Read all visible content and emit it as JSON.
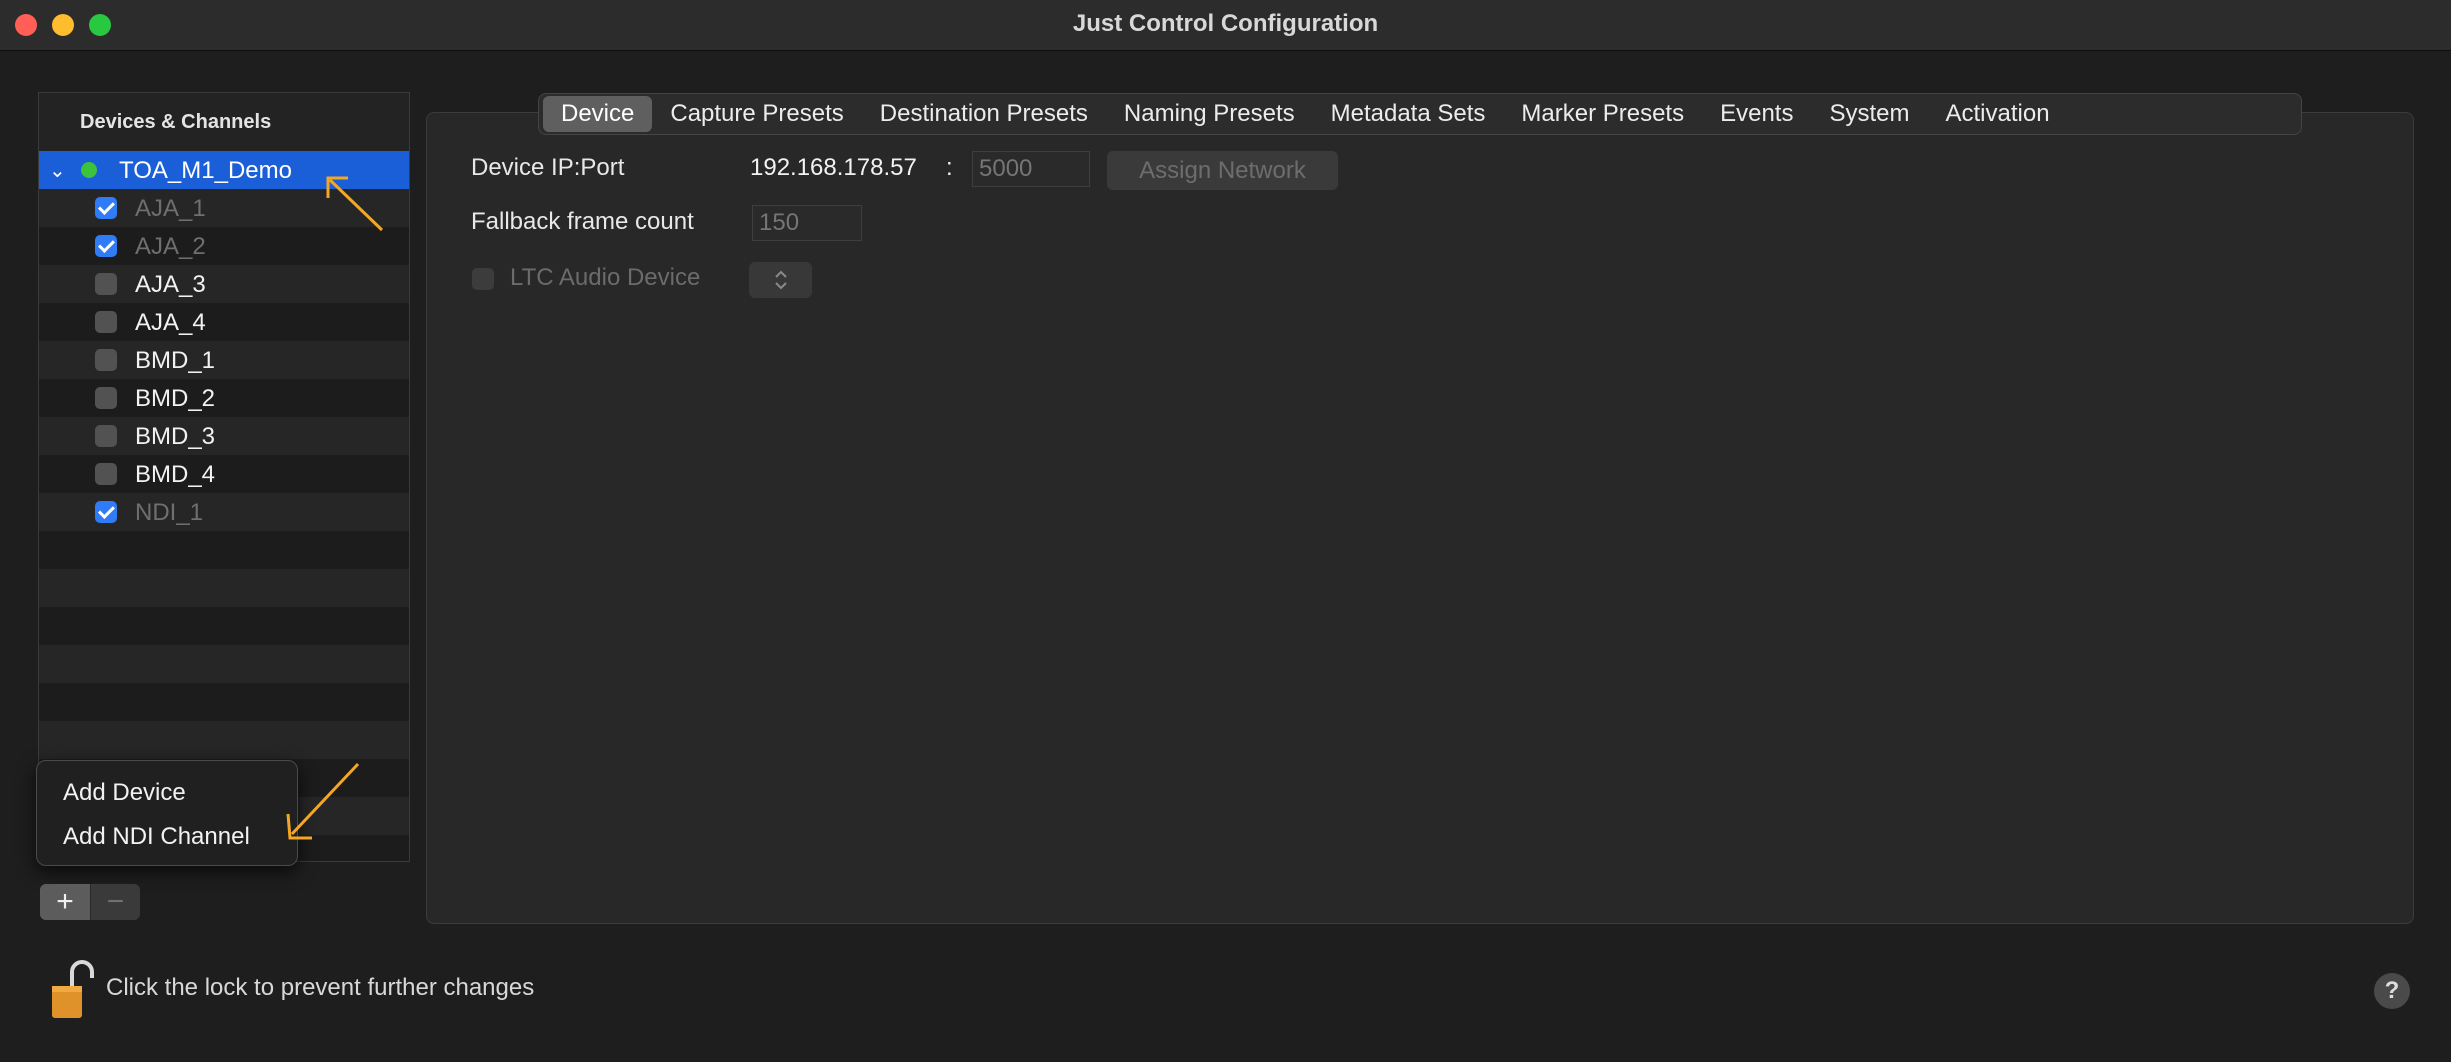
{
  "window": {
    "title": "Just Control Configuration"
  },
  "sidebar": {
    "header": "Devices & Channels",
    "device": {
      "name": "TOA_M1_Demo",
      "status": "online",
      "expanded": true
    },
    "channels": [
      {
        "label": "AJA_1",
        "checked": true,
        "dimmed": true
      },
      {
        "label": "AJA_2",
        "checked": true,
        "dimmed": true
      },
      {
        "label": "AJA_3",
        "checked": false,
        "dimmed": false
      },
      {
        "label": "AJA_4",
        "checked": false,
        "dimmed": false
      },
      {
        "label": "BMD_1",
        "checked": false,
        "dimmed": false
      },
      {
        "label": "BMD_2",
        "checked": false,
        "dimmed": false
      },
      {
        "label": "BMD_3",
        "checked": false,
        "dimmed": false
      },
      {
        "label": "BMD_4",
        "checked": false,
        "dimmed": false
      },
      {
        "label": "NDI_1",
        "checked": true,
        "dimmed": true
      }
    ],
    "add_label": "+",
    "remove_label": "−"
  },
  "popup_menu": {
    "items": [
      "Add Device",
      "Add NDI Channel"
    ]
  },
  "tabs": [
    "Device",
    "Capture Presets",
    "Destination Presets",
    "Naming Presets",
    "Metadata Sets",
    "Marker Presets",
    "Events",
    "System",
    "Activation"
  ],
  "active_tab": "Device",
  "device_form": {
    "ip_label": "Device IP:Port",
    "ip_value": "192.168.178.57",
    "colon": ":",
    "port_placeholder": "5000",
    "assign_button": "Assign Network",
    "fallback_label": "Fallback frame count",
    "fallback_placeholder": "150",
    "ltc_label": "LTC Audio Device",
    "ltc_checked": false
  },
  "footer": {
    "lock_text": "Click the lock to prevent further changes",
    "help_label": "?"
  },
  "colors": {
    "accent": "#1b5fd8",
    "checkbox": "#2f7cf6",
    "status_online": "#3cc33c",
    "annotation_arrow": "#f5a623"
  },
  "icons": [
    "chevron-down-icon",
    "status-dot-icon",
    "arrow-annotation-icon",
    "lock-open-icon",
    "help-icon",
    "stepper-icon"
  ]
}
